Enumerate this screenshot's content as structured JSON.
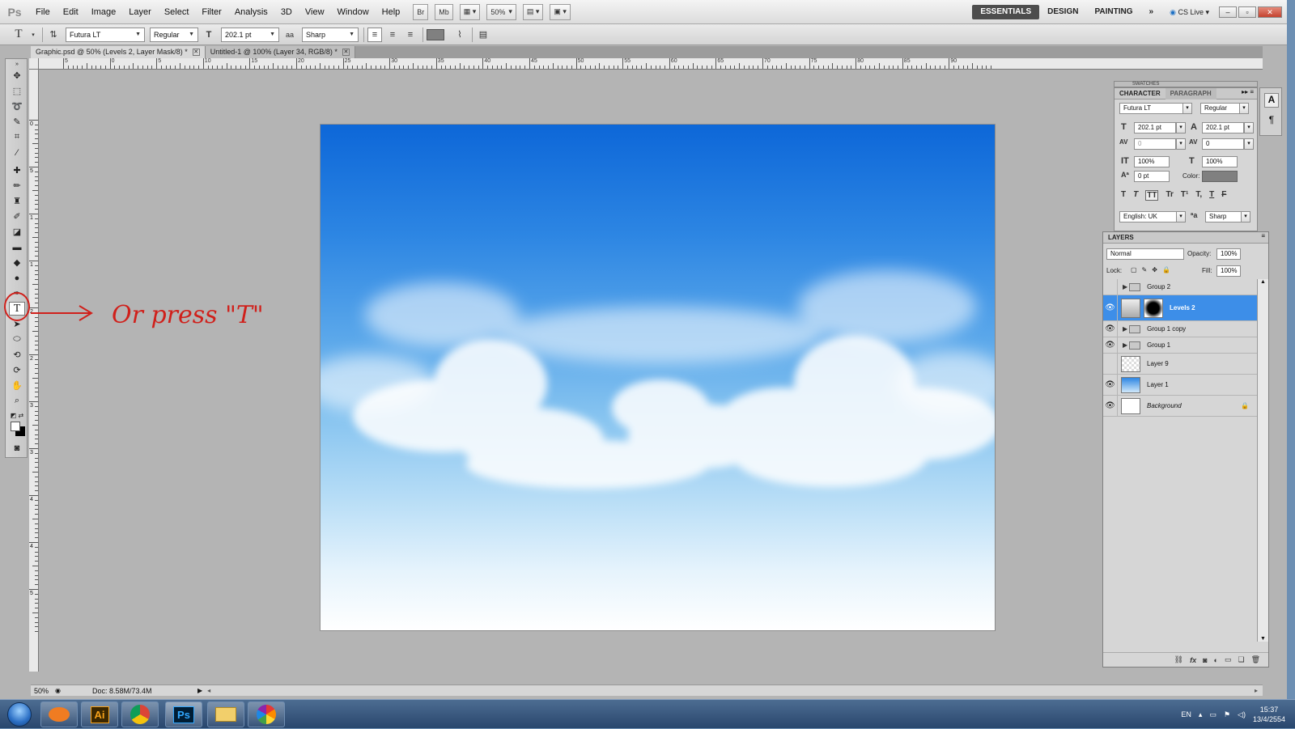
{
  "app": {
    "logo": "Ps"
  },
  "menu": [
    "File",
    "Edit",
    "Image",
    "Layer",
    "Select",
    "Filter",
    "Analysis",
    "3D",
    "View",
    "Window",
    "Help"
  ],
  "menubar": {
    "bridge_btn": "Br",
    "minibridge_btn": "Mb",
    "zoom": "50%",
    "workspaces": [
      "ESSENTIALS",
      "DESIGN",
      "PAINTING"
    ],
    "more": "»",
    "cslive": "CS Live"
  },
  "options": {
    "tool_icon": "T",
    "font_family": "Futura LT",
    "font_style": "Regular",
    "font_size": "202.1 pt",
    "aa_label": "a",
    "aa_mode": "Sharp"
  },
  "tabs": [
    {
      "label": "Graphic.psd @ 50% (Levels 2, Layer Mask/8) *"
    },
    {
      "label": "Untitled-1 @ 100% (Layer 34, RGB/8) *"
    }
  ],
  "ruler": {
    "labels": [
      "5",
      "0",
      "5",
      "10",
      "15",
      "20",
      "25",
      "30",
      "35",
      "40",
      "45",
      "50",
      "55",
      "60",
      "65",
      "70",
      "75",
      "80",
      "85",
      "90"
    ],
    "vlabels": [
      "0",
      "5",
      "1",
      "1",
      "2",
      "2",
      "3",
      "3",
      "4",
      "4",
      "5"
    ]
  },
  "status": {
    "zoom": "50%",
    "doc": "Doc: 8.58M/73.4M"
  },
  "character_panel": {
    "tabs": [
      "CHARACTER",
      "PARAGRAPH"
    ],
    "swatches_tab": "SWATCHES",
    "font_family": "Futura LT",
    "font_style": "Regular",
    "size": "202.1 pt",
    "leading": "202.1 pt",
    "kerning": "0",
    "tracking": "0",
    "vscale": "100%",
    "hscale": "100%",
    "baseline": "0 pt",
    "color_label": "Color:",
    "language": "English: UK",
    "aa": "Sharp",
    "style_buttons": [
      "T",
      "T",
      "TT",
      "Tr",
      "T¹",
      "T,",
      "T",
      "F"
    ]
  },
  "layers_panel": {
    "title": "LAYERS",
    "blend_mode": "Normal",
    "opacity_label": "Opacity:",
    "opacity": "100%",
    "lock_label": "Lock:",
    "fill_label": "Fill:",
    "fill": "100%",
    "layers": [
      {
        "name": "Group 2",
        "kind": "group",
        "visible": false
      },
      {
        "name": "Levels 2",
        "kind": "adjustment",
        "visible": true,
        "selected": true
      },
      {
        "name": "Group 1 copy",
        "kind": "group",
        "visible": true
      },
      {
        "name": "Group 1",
        "kind": "group",
        "visible": true
      },
      {
        "name": "Layer 9",
        "kind": "layer",
        "visible": false
      },
      {
        "name": "Layer 1",
        "kind": "layer",
        "visible": true
      },
      {
        "name": "Background",
        "kind": "background",
        "visible": true
      }
    ],
    "footer_icons": [
      "link-icon",
      "fx-icon",
      "mask-icon",
      "adjustment-icon",
      "folder-icon",
      "new-layer-icon",
      "trash-icon"
    ]
  },
  "annotation": {
    "text": "Or press \"T\""
  },
  "taskbar": {
    "apps": [
      "mail-icon",
      "illustrator-icon",
      "chrome-icon",
      "photoshop-icon",
      "explorer-icon",
      "picasa-icon"
    ],
    "ai_label": "Ai",
    "ps_label": "Ps",
    "lang": "EN",
    "time": "15:37",
    "date": "13/4/2554"
  },
  "colors": {
    "accent_selection": "#3d8ee8",
    "sky_top": "#0d67d8",
    "annotation": "#d0201b"
  }
}
